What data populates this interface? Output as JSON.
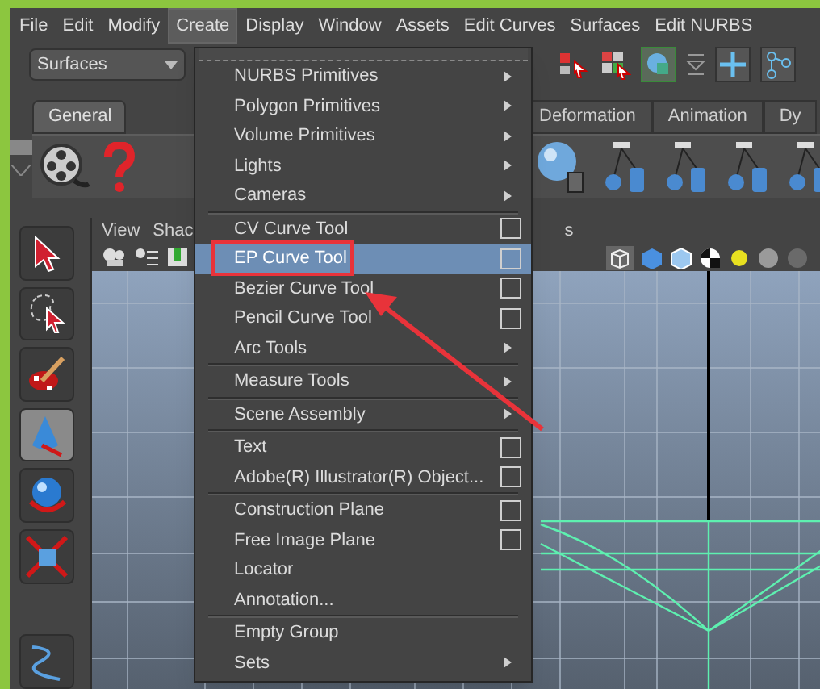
{
  "menu_bar": [
    {
      "label": "File",
      "selected": false
    },
    {
      "label": "Edit",
      "selected": false
    },
    {
      "label": "Modify",
      "selected": false
    },
    {
      "label": "Create",
      "selected": true
    },
    {
      "label": "Display",
      "selected": false
    },
    {
      "label": "Window",
      "selected": false
    },
    {
      "label": "Assets",
      "selected": false
    },
    {
      "label": "Edit Curves",
      "selected": false
    },
    {
      "label": "Surfaces",
      "selected": false
    },
    {
      "label": "Edit NURBS",
      "selected": false
    }
  ],
  "toolbar": {
    "mode_dropdown": "Surfaces"
  },
  "shelf_tabs": [
    {
      "label": "General",
      "selected": true
    },
    {
      "label": "Deformation",
      "selected": false
    },
    {
      "label": "Animation",
      "selected": false
    },
    {
      "label": "Dy",
      "selected": false
    }
  ],
  "viewport_menu": [
    "View",
    "Shac",
    "s"
  ],
  "create_menu": {
    "items": [
      {
        "label": "NURBS Primitives",
        "kind": "submenu",
        "selected": false,
        "divider_before": false,
        "marked": false
      },
      {
        "label": "Polygon Primitives",
        "kind": "submenu",
        "selected": false,
        "divider_before": false,
        "marked": false
      },
      {
        "label": "Volume Primitives",
        "kind": "submenu",
        "selected": false,
        "divider_before": false,
        "marked": false
      },
      {
        "label": "Lights",
        "kind": "submenu",
        "selected": false,
        "divider_before": false,
        "marked": false
      },
      {
        "label": "Cameras",
        "kind": "submenu",
        "selected": false,
        "divider_before": false,
        "marked": false
      },
      {
        "label": "CV Curve Tool",
        "kind": "option",
        "selected": false,
        "divider_before": true,
        "marked": false
      },
      {
        "label": "EP Curve Tool",
        "kind": "option",
        "selected": true,
        "divider_before": false,
        "marked": true
      },
      {
        "label": "Bezier Curve Tool",
        "kind": "option",
        "selected": false,
        "divider_before": false,
        "marked": false
      },
      {
        "label": "Pencil Curve Tool",
        "kind": "option",
        "selected": false,
        "divider_before": false,
        "marked": false
      },
      {
        "label": "Arc Tools",
        "kind": "submenu",
        "selected": false,
        "divider_before": false,
        "marked": false
      },
      {
        "label": "Measure Tools",
        "kind": "submenu",
        "selected": false,
        "divider_before": true,
        "marked": false
      },
      {
        "label": "Scene Assembly",
        "kind": "submenu",
        "selected": false,
        "divider_before": true,
        "marked": false
      },
      {
        "label": "Text",
        "kind": "option",
        "selected": false,
        "divider_before": true,
        "marked": false
      },
      {
        "label": "Adobe(R) Illustrator(R) Object...",
        "kind": "option",
        "selected": false,
        "divider_before": false,
        "marked": false
      },
      {
        "label": "Construction Plane",
        "kind": "option",
        "selected": false,
        "divider_before": true,
        "marked": false
      },
      {
        "label": "Free Image Plane",
        "kind": "option",
        "selected": false,
        "divider_before": false,
        "marked": false
      },
      {
        "label": "Locator",
        "kind": "plain",
        "selected": false,
        "divider_before": false,
        "marked": false
      },
      {
        "label": "Annotation...",
        "kind": "plain",
        "selected": false,
        "divider_before": false,
        "marked": false
      },
      {
        "label": "Empty Group",
        "kind": "plain",
        "selected": false,
        "divider_before": true,
        "marked": false
      },
      {
        "label": "Sets",
        "kind": "submenu",
        "selected": false,
        "divider_before": false,
        "marked": false
      }
    ]
  }
}
